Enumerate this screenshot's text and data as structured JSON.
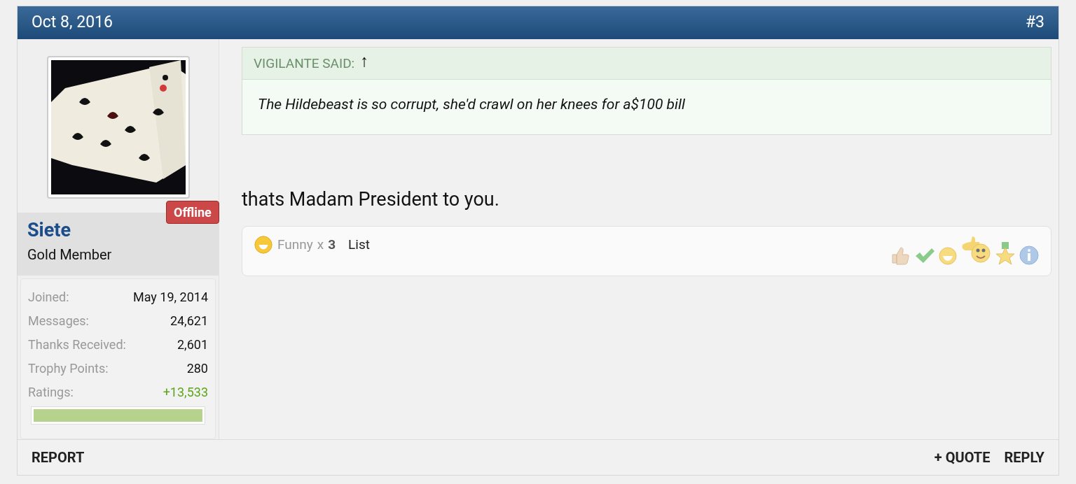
{
  "header": {
    "date": "Oct 8, 2016",
    "post_number": "#3"
  },
  "user": {
    "status": "Offline",
    "name": "Siete",
    "title": "Gold Member",
    "stats": [
      {
        "label": "Joined:",
        "value": "May 19, 2014",
        "kind": "plain"
      },
      {
        "label": "Messages:",
        "value": "24,621",
        "kind": "plain"
      },
      {
        "label": "Thanks Received:",
        "value": "2,601",
        "kind": "plain"
      },
      {
        "label": "Trophy Points:",
        "value": "280",
        "kind": "plain"
      },
      {
        "label": "Ratings:",
        "value": "+13,533",
        "kind": "positive"
      }
    ],
    "rating_bar": {
      "level": 1
    }
  },
  "quote": {
    "author": "VIGILANTE SAID:",
    "jump": "↑",
    "text": "The Hildebeast is so corrupt, she'd crawl on her knees for a$100 bill"
  },
  "message": "thats Madam President to you.",
  "reactions": {
    "label": "Funny",
    "times": "x",
    "count": "3",
    "list": "List"
  },
  "footer": {
    "left": [
      "REPORT"
    ],
    "right": [
      "+ QUOTE",
      "REPLY"
    ]
  }
}
